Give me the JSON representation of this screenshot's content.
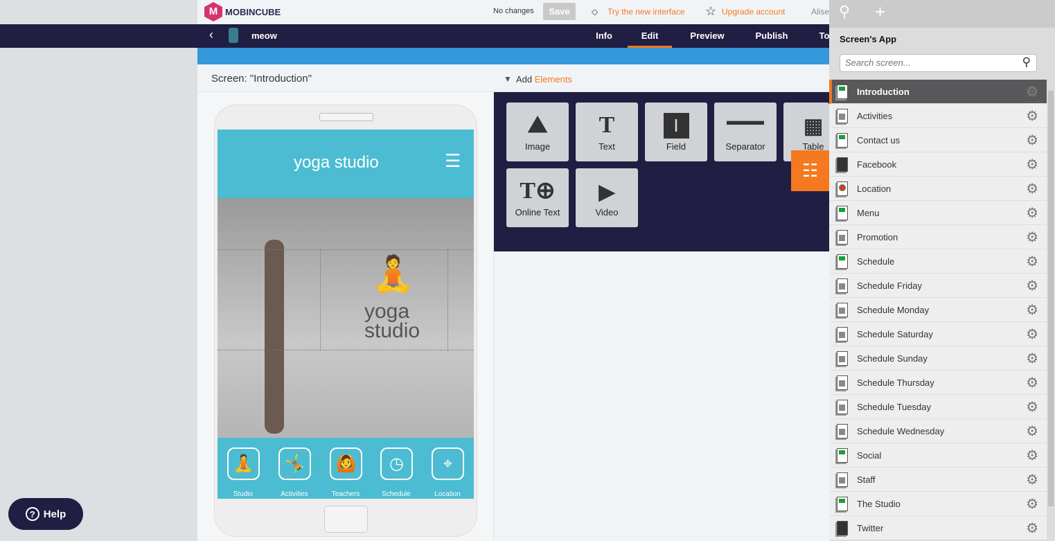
{
  "header": {
    "brand": "MOBINCUBE",
    "status": "No changes",
    "save": "Save",
    "try_new": "Try the new interface",
    "upgrade": "Upgrade account",
    "user": "Alise"
  },
  "nav": {
    "app_name": "meow",
    "tabs": [
      {
        "label": "Info"
      },
      {
        "label": "Edit",
        "active": true
      },
      {
        "label": "Preview"
      },
      {
        "label": "Publish"
      },
      {
        "label": "To"
      }
    ]
  },
  "screen": {
    "title": "Screen: \"Introduction\"",
    "add": "Add",
    "elements": "Elements"
  },
  "elements": [
    {
      "label": "Image",
      "icon": "image-icon"
    },
    {
      "label": "Text",
      "icon": "text-icon"
    },
    {
      "label": "Field",
      "icon": "field-icon"
    },
    {
      "label": "Separator",
      "icon": "separator-icon"
    },
    {
      "label": "Table",
      "icon": "table-icon"
    },
    {
      "label": "Online Text",
      "icon": "online-text-icon"
    },
    {
      "label": "Video",
      "icon": "video-icon"
    }
  ],
  "phone": {
    "header_logo": "yoga studio",
    "hero_logo_line1": "yoga",
    "hero_logo_line2": "studio",
    "nav": [
      {
        "label": "Studio"
      },
      {
        "label": "Activities"
      },
      {
        "label": "Teachers"
      },
      {
        "label": "Schedule"
      },
      {
        "label": "Location"
      }
    ]
  },
  "panel": {
    "title": "Screen's App",
    "search_placeholder": "Search screen...",
    "screens": [
      {
        "name": "Introduction",
        "type": "green",
        "selected": true
      },
      {
        "name": "Activities",
        "type": "grey"
      },
      {
        "name": "Contact us",
        "type": "green"
      },
      {
        "name": "Facebook",
        "type": "web"
      },
      {
        "name": "Location",
        "type": "map"
      },
      {
        "name": "Menu",
        "type": "green"
      },
      {
        "name": "Promotion",
        "type": "grey"
      },
      {
        "name": "Schedule",
        "type": "green"
      },
      {
        "name": "Schedule Friday",
        "type": "grey"
      },
      {
        "name": "Schedule Monday",
        "type": "grey"
      },
      {
        "name": "Schedule Saturday",
        "type": "grey"
      },
      {
        "name": "Schedule Sunday",
        "type": "grey"
      },
      {
        "name": "Schedule Thursday",
        "type": "grey"
      },
      {
        "name": "Schedule Tuesday",
        "type": "grey"
      },
      {
        "name": "Schedule Wednesday",
        "type": "grey"
      },
      {
        "name": "Social",
        "type": "green"
      },
      {
        "name": "Staff",
        "type": "grey"
      },
      {
        "name": "The Studio",
        "type": "green"
      },
      {
        "name": "Twitter",
        "type": "web"
      }
    ]
  },
  "help": "Help",
  "colors": {
    "accent": "#f47920",
    "navy": "#201e42",
    "blue": "#3498db",
    "teal": "#4bbcd1"
  }
}
